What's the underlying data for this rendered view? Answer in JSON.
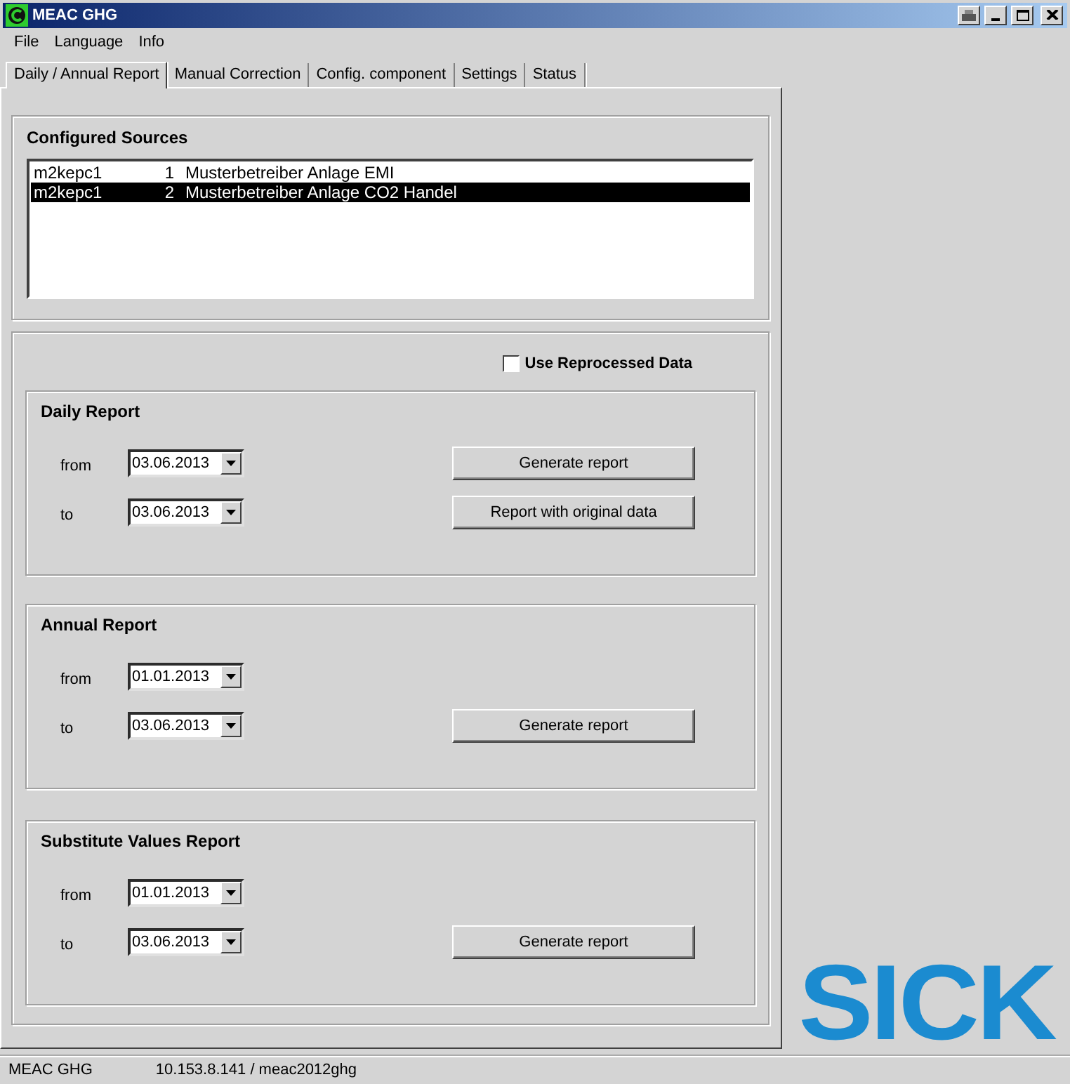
{
  "window": {
    "title": "MEAC GHG"
  },
  "menu": [
    "File",
    "Language",
    "Info"
  ],
  "tabs": [
    {
      "label": "Daily / Annual Report",
      "selected": true
    },
    {
      "label": "Manual Correction",
      "selected": false
    },
    {
      "label": "Config. component",
      "selected": false
    },
    {
      "label": "Settings",
      "selected": false
    },
    {
      "label": "Status",
      "selected": false
    }
  ],
  "sources": {
    "title": "Configured Sources",
    "rows": [
      {
        "host": "m2kepc1",
        "number": "1",
        "name": "Musterbetreiber Anlage EMI",
        "selected": false
      },
      {
        "host": "m2kepc1",
        "number": "2",
        "name": "Musterbetreiber Anlage CO2 Handel",
        "selected": true
      }
    ]
  },
  "use_reprocessed": {
    "label": "Use Reprocessed Data",
    "checked": false
  },
  "reports": [
    {
      "title": "Daily Report",
      "from_label": "from",
      "from": "03.06.2013",
      "to_label": "to",
      "to": "03.06.2013",
      "buttons": [
        "Generate report",
        "Report with original data"
      ]
    },
    {
      "title": "Annual Report",
      "from_label": "from",
      "from": "01.01.2013",
      "to_label": "to",
      "to": "03.06.2013",
      "buttons": [
        "Generate report"
      ]
    },
    {
      "title": "Substitute Values Report",
      "from_label": "from",
      "from": "01.01.2013",
      "to_label": "to",
      "to": "03.06.2013",
      "buttons": [
        "Generate report"
      ]
    }
  ],
  "logo": "SICK",
  "status_bar": [
    "MEAC GHG",
    "10.153.8.141 / meac2012ghg"
  ]
}
